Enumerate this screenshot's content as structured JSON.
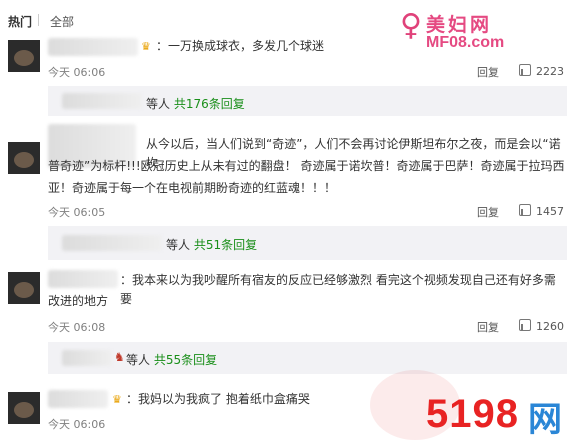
{
  "tabs": {
    "hot": "热门",
    "all": "全部"
  },
  "logo_top": {
    "chinese": "美妇网",
    "url": "MF08.com"
  },
  "comments": [
    {
      "text": "：一万换成球衣，多发几个球迷",
      "time": "今天 06:06",
      "reply": "回复",
      "likes": "2223"
    },
    {
      "text_line1": "从今以后，当人们说到“奇迹”，人们不会再讨论伊斯坦布尔之夜，而是会以“诺坎",
      "text_line2": "普奇迹”为标杆!!!欧冠历史上从未有过的翻盘！ 奇迹属于诺坎普！奇迹属于巴萨！奇迹属于拉玛西",
      "text_line3": "亚！奇迹属于每一个在电视前期盼奇迹的红蓝魂！！！",
      "time": "今天 06:05",
      "reply": "回复",
      "likes": "1457"
    },
    {
      "text_line1": "：我本来以为我吵醒所有宿友的反应已经够激烈  看完这个视频发现自己还有好多需要",
      "text_line2": "改进的地方",
      "time": "今天 06:08",
      "reply": "回复",
      "likes": "1260"
    },
    {
      "text": "：我妈以为我疯了  抱着纸巾盒痛哭",
      "time": "今天 06:06"
    }
  ],
  "sub_replies": [
    {
      "prefix": "等人",
      "count": "共176条回复"
    },
    {
      "prefix": "等人",
      "count": "共51条回复"
    },
    {
      "prefix": "等人",
      "count": "共55条回复"
    }
  ],
  "logo_bottom": {
    "number": "5198",
    "suffix": "网"
  }
}
